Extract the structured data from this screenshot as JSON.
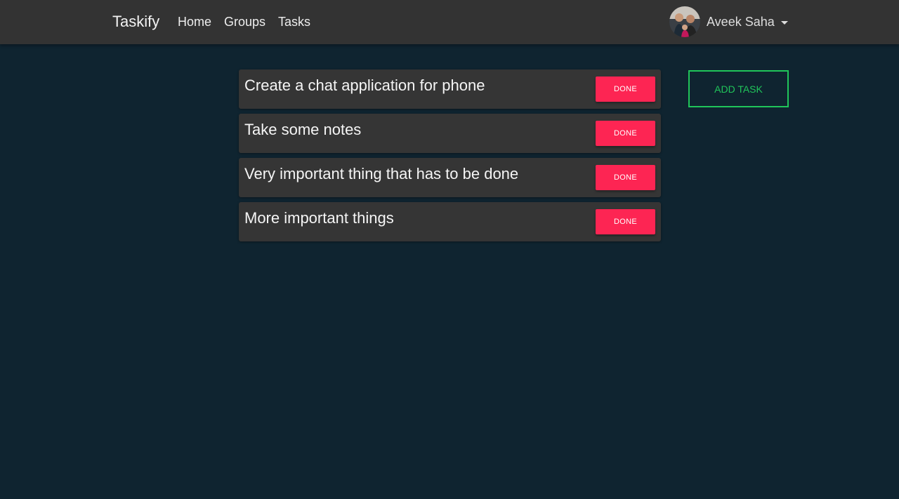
{
  "navbar": {
    "brand": "Taskify",
    "links": [
      {
        "label": "Home"
      },
      {
        "label": "Groups"
      },
      {
        "label": "Tasks"
      }
    ],
    "user": {
      "name": "Aveek Saha",
      "avatar_icon": "user-avatar-photo"
    }
  },
  "tasks": [
    {
      "title": "Create a chat application for phone",
      "action_label": "DONE"
    },
    {
      "title": "Take some notes",
      "action_label": "DONE"
    },
    {
      "title": "Very important thing that has to be done",
      "action_label": "DONE"
    },
    {
      "title": "More important things",
      "action_label": "DONE"
    }
  ],
  "add_task_label": "ADD TASK",
  "colors": {
    "background": "#0f2430",
    "navbar": "#333333",
    "card": "#353535",
    "done_button": "#fd2553",
    "add_task_accent": "#20c55a"
  }
}
